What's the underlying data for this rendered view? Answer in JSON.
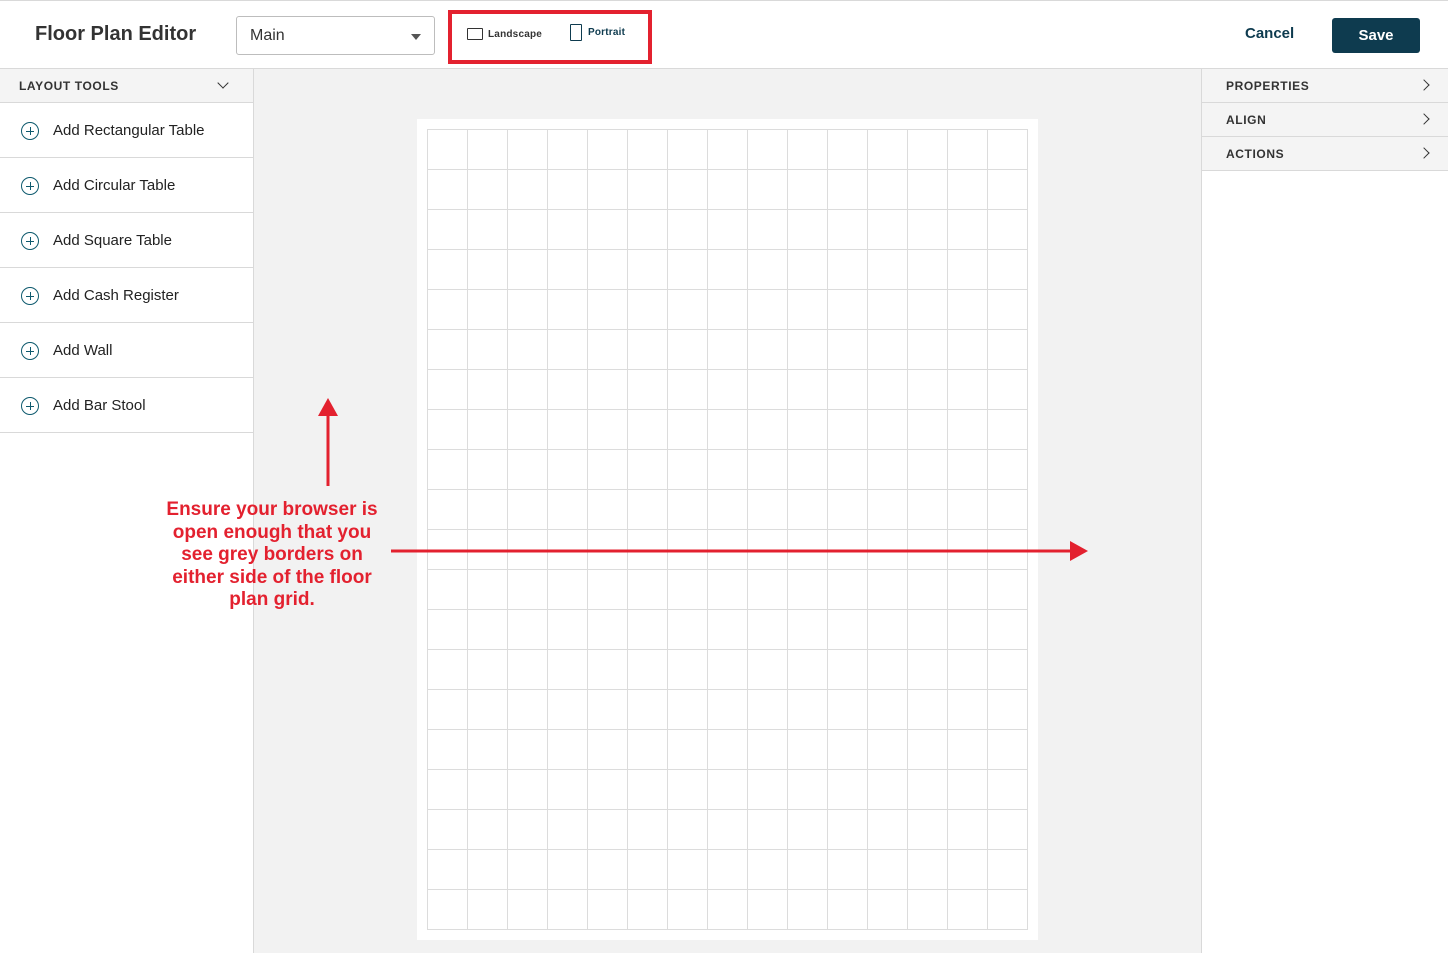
{
  "header": {
    "title": "Floor Plan Editor",
    "floor_select": {
      "value": "Main"
    },
    "orientation": {
      "landscape_label": "Landscape",
      "portrait_label": "Portrait",
      "selected": "Portrait"
    },
    "cancel_label": "Cancel",
    "save_label": "Save"
  },
  "left_panel": {
    "title": "LAYOUT TOOLS",
    "items": [
      {
        "label": "Add Rectangular Table",
        "icon": "plus-circle-icon"
      },
      {
        "label": "Add Circular Table",
        "icon": "plus-circle-icon"
      },
      {
        "label": "Add Square Table",
        "icon": "plus-circle-icon"
      },
      {
        "label": "Add Cash Register",
        "icon": "plus-circle-icon"
      },
      {
        "label": "Add Wall",
        "icon": "plus-circle-icon"
      },
      {
        "label": "Add Bar Stool",
        "icon": "plus-circle-icon"
      }
    ]
  },
  "right_panel": {
    "sections": [
      {
        "label": "PROPERTIES"
      },
      {
        "label": "ALIGN"
      },
      {
        "label": "ACTIONS"
      }
    ]
  },
  "annotation": {
    "text": "Ensure your browser is open enough that you see grey borders on either side of the floor plan grid.",
    "color": "#e3212f"
  },
  "colors": {
    "primary": "#0e3b4f",
    "annotation_red": "#e3212f",
    "canvas_bg": "#f2f2f2"
  }
}
